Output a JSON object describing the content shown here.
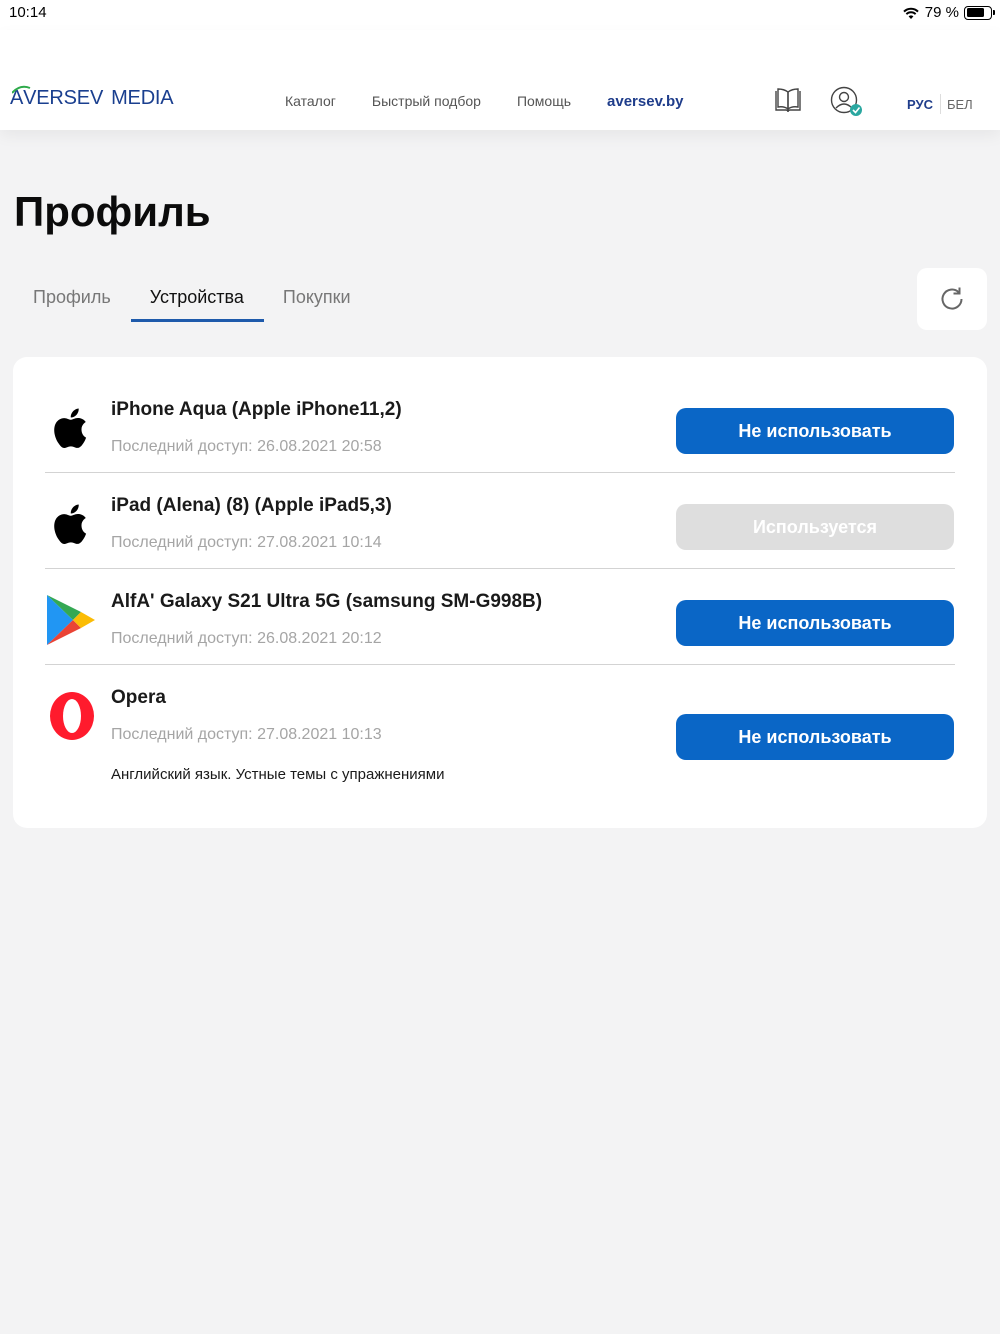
{
  "status_bar": {
    "time": "10:14",
    "battery": "79 %",
    "battery_level": 0.79
  },
  "header": {
    "logo": {
      "a": "A",
      "brand": "VERSEV",
      "media": "MEDIA"
    },
    "nav": [
      "Каталог",
      "Быстрый подбор",
      "Помощь"
    ],
    "site_link": "aversev.by",
    "icons": [
      "book-icon",
      "user-verified-icon"
    ],
    "lang": {
      "ru": "РУС",
      "be": "БЕЛ"
    }
  },
  "page_title": "Профиль",
  "tabs": [
    {
      "label": "Профиль",
      "active": false
    },
    {
      "label": "Устройства",
      "active": true
    },
    {
      "label": "Покупки",
      "active": false
    }
  ],
  "refresh_icon": "refresh-icon",
  "devices": [
    {
      "icon": "apple-icon",
      "name": "iPhone Aqua (Apple iPhone11,2)",
      "last_access": "Последний доступ: 26.08.2021 20:58",
      "button": "Не использовать",
      "button_disabled": false
    },
    {
      "icon": "apple-icon",
      "name": "iPad (Alena) (8) (Apple iPad5,3)",
      "last_access": "Последний доступ: 27.08.2021 10:14",
      "button": "Используется",
      "button_disabled": true
    },
    {
      "icon": "google-play-icon",
      "name": "AlfA' Galaxy S21 Ultra 5G (samsung SM-G998B)",
      "last_access": "Последний доступ: 26.08.2021 20:12",
      "button": "Не использовать",
      "button_disabled": false
    },
    {
      "icon": "opera-icon",
      "name": "Opera",
      "last_access": "Последний доступ: 27.08.2021 10:13",
      "extra": "Английский язык. Устные темы с упражнениями",
      "button": "Не использовать",
      "button_disabled": false
    }
  ],
  "colors": {
    "accent": "#0a66c6",
    "brand": "#1f3d8b",
    "disabled": "#dedede"
  }
}
